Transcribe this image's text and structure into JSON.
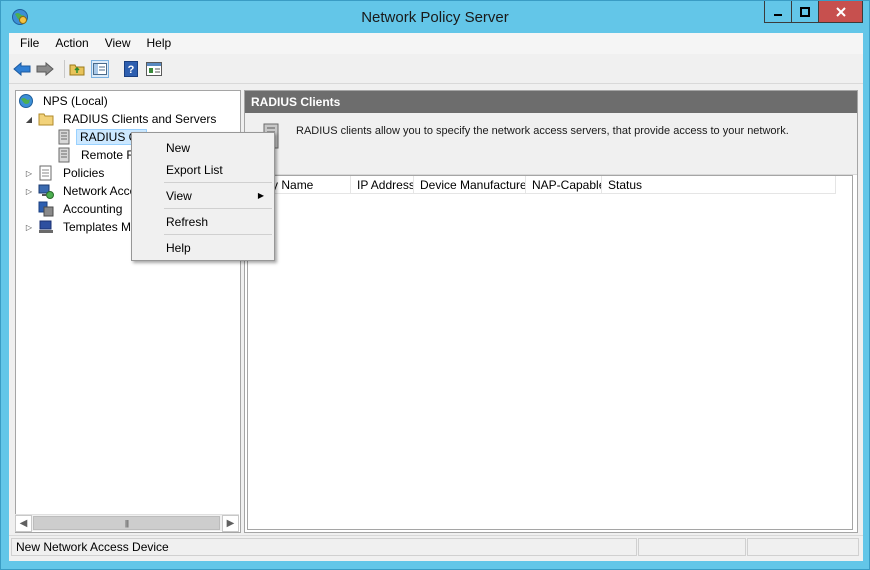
{
  "window": {
    "title": "Network Policy Server"
  },
  "menu": [
    "File",
    "Action",
    "View",
    "Help"
  ],
  "toolbar": {
    "icons": [
      "back-arrow-icon",
      "forward-arrow-icon",
      "up-folder-icon",
      "show-hide-tree-icon",
      "help-icon",
      "properties-icon"
    ]
  },
  "tree": {
    "root": "NPS (Local)",
    "radius_clients_servers": "RADIUS Clients and Servers",
    "radius_clients": "RADIUS Cli",
    "remote_radius": "Remote RA",
    "policies": "Policies",
    "network_access": "Network Acce",
    "accounting": "Accounting",
    "templates": "Templates Ma"
  },
  "right_pane": {
    "header": "RADIUS Clients",
    "info": "RADIUS clients allow you to specify the network access servers, that provide access to your network.",
    "columns": [
      "ndly Name",
      "IP Address",
      "Device Manufacturer",
      "NAP-Capable",
      "Status"
    ]
  },
  "context_menu": {
    "items": [
      "New",
      "Export List",
      "View",
      "Refresh",
      "Help"
    ]
  },
  "status": {
    "text": "New Network Access Device"
  },
  "colors": {
    "title_bar": "#63c6e8",
    "close_button": "#c7504e",
    "pane_header": "#6d6d6d",
    "selection": "#cce8ff"
  }
}
